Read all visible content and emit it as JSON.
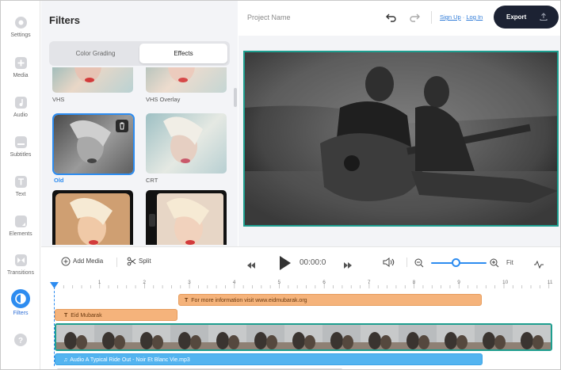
{
  "sidebar": {
    "items": [
      {
        "label": "Settings",
        "icon": "gear-icon"
      },
      {
        "label": "Media",
        "icon": "plus-icon"
      },
      {
        "label": "Audio",
        "icon": "music-note-icon"
      },
      {
        "label": "Subtitles",
        "icon": "subtitles-icon"
      },
      {
        "label": "Text",
        "icon": "text-icon"
      },
      {
        "label": "Elements",
        "icon": "elements-icon"
      },
      {
        "label": "Transitions",
        "icon": "transitions-icon"
      },
      {
        "label": "Filters",
        "icon": "filters-icon",
        "active": true
      },
      {
        "label": "",
        "icon": "help-icon"
      }
    ]
  },
  "filters_panel": {
    "title": "Filters",
    "tabs": [
      {
        "label": "Color Grading",
        "active": false
      },
      {
        "label": "Effects",
        "active": true
      }
    ],
    "items": [
      {
        "label": "VHS",
        "selected": false
      },
      {
        "label": "VHS Overlay",
        "selected": false
      },
      {
        "label": "Old",
        "selected": true
      },
      {
        "label": "CRT",
        "selected": false
      },
      {
        "label": "",
        "selected": false
      },
      {
        "label": "",
        "selected": false
      }
    ]
  },
  "topbar": {
    "project_name": "Project Name",
    "sign_up": "Sign Up",
    "separator": "·",
    "log_in": "Log In",
    "export_label": "Export"
  },
  "timeline": {
    "add_media": "Add Media",
    "split": "Split",
    "timecode": "00:00:0",
    "zoom_level": 0.45,
    "fit_label": "Fit",
    "ruler_ticks": [
      "1",
      "2",
      "3",
      "4",
      "5",
      "6",
      "7",
      "8",
      "9",
      "10",
      "11"
    ],
    "clips": {
      "text_1": "For more information  visit www.eidmubarak.org",
      "text_2": "Eid Mubarak",
      "audio": "Audio A Typical Ride Out - Noir Et Blanc Vie.mp3"
    }
  },
  "colors": {
    "accent": "#2d8cf0",
    "export_bg": "#1c2233",
    "text_clip": "#f5b37b",
    "audio_clip": "#53b4f0",
    "preview_border": "#1e9e8f"
  }
}
